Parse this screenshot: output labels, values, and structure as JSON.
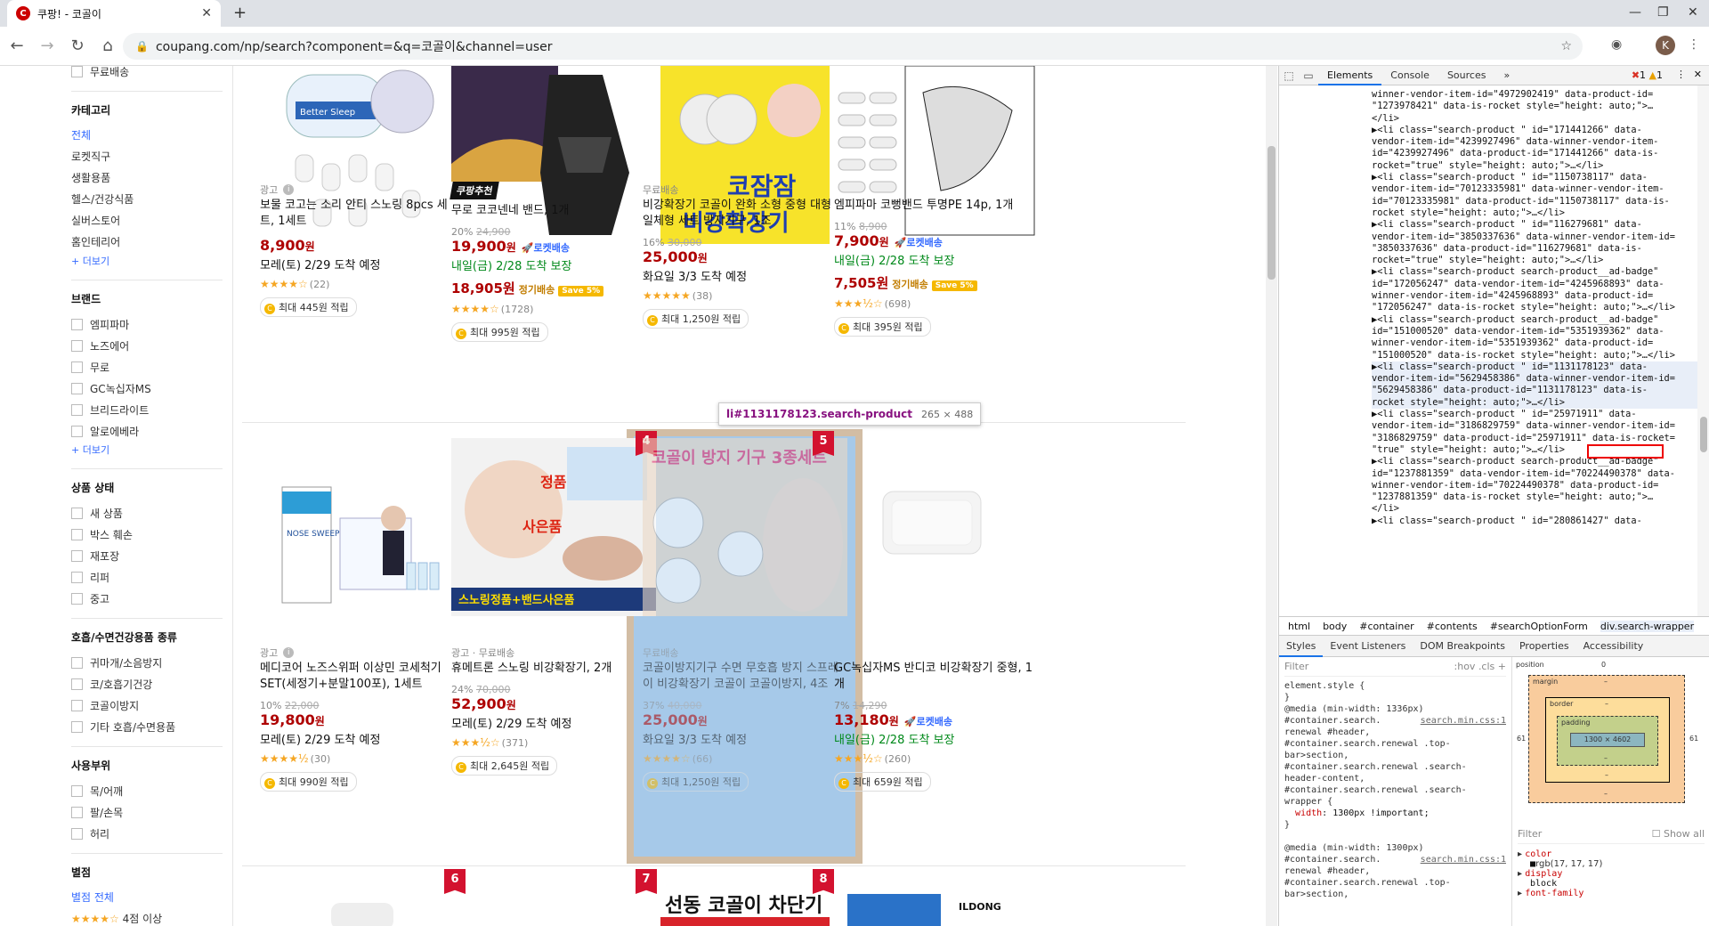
{
  "browser": {
    "tab_title": "쿠팡! - 코골이",
    "favicon": "C",
    "url": "coupang.com/np/search?component=&q=코골이&channel=user",
    "avatar": "K"
  },
  "sidebar": {
    "top_item": "무료배송",
    "category_title": "카테고리",
    "categories": [
      "전체",
      "로켓직구",
      "생활용품",
      "헬스/건강식품",
      "실버스토어",
      "홈인테리어"
    ],
    "more": "+ 더보기",
    "brand_title": "브랜드",
    "brands": [
      "엠피파마",
      "노즈에어",
      "무로",
      "GC녹십자MS",
      "브리드라이트",
      "알로에베라"
    ],
    "condition_title": "상품 상태",
    "conditions": [
      "새 상품",
      "박스 훼손",
      "재포장",
      "리퍼",
      "중고"
    ],
    "sleep_title": "호흡/수면건강용품 종류",
    "sleep_types": [
      "귀마개/소음방지",
      "코/호흡기건강",
      "코골이방지",
      "기타 호흡/수면용품"
    ],
    "usage_title": "사용부위",
    "usage": [
      "목/어깨",
      "팔/손목",
      "허리"
    ],
    "rating_title": "별점",
    "rating_all": "별점 전체",
    "rating_4": "4점 이상"
  },
  "products": [
    {
      "meta": "광고",
      "name": "보물 코고는 소리 안티 스노링 8pcs 세트, 1세트",
      "discount": "",
      "orig": "",
      "price": "8,900",
      "won": "원",
      "rocket": "",
      "delivery": "모레(토) 2/29 도착 예정",
      "green": false,
      "price2": "",
      "rating": "★★★★☆",
      "count": "(22)",
      "cash": "최대 445원 적립"
    },
    {
      "badge": "쿠팡추천",
      "meta": "",
      "name": "무로 코코넨네 밴드, 1개",
      "discount": "20%",
      "orig": "24,900",
      "price": "19,900",
      "won": "원",
      "rocket": "로켓배송",
      "delivery": "내일(금) 2/28 도착 보장",
      "green": true,
      "price2": "18,905",
      "sub": "정기배송",
      "save": "Save 5%",
      "rating": "★★★★☆",
      "count": "(1728)",
      "cash": "최대 995원 적립"
    },
    {
      "meta": "무료배송",
      "name": "비강확장기 코골이 완화 소형 중형 대형 일체형 세트 방지기구, 1조",
      "discount": "16%",
      "orig": "30,000",
      "price": "25,000",
      "won": "원",
      "rocket": "",
      "delivery": "화요일 3/3 도착 예정",
      "green": false,
      "price2": "",
      "rating": "★★★★★",
      "count": "(38)",
      "cash": "최대 1,250원 적립"
    },
    {
      "meta": "",
      "name": "엠피파마 코뻥밴드 투명PE 14p, 1개",
      "discount": "11%",
      "orig": "8,900",
      "price": "7,900",
      "won": "원",
      "rocket": "로켓배송",
      "delivery": "내일(금) 2/28 도착 보장",
      "green": true,
      "price2": "7,505",
      "sub": "정기배송",
      "save": "Save 5%",
      "rating": "★★★½☆",
      "count": "(698)",
      "cash": "최대 395원 적립"
    },
    {
      "meta": "광고",
      "name": "메디코어 노즈스위퍼 이상민 코세척기SET(세정기+분말100포), 1세트",
      "discount": "10%",
      "orig": "22,000",
      "price": "19,800",
      "won": "원",
      "rocket": "",
      "delivery": "모레(토) 2/29 도착 예정",
      "green": false,
      "price2": "",
      "rating": "★★★★½",
      "count": "(30)",
      "cash": "최대 990원 적립"
    },
    {
      "meta": "광고 · 무료배송",
      "name": "휴메트론 스노링 비강확장기, 2개",
      "discount": "24%",
      "orig": "70,000",
      "price": "52,900",
      "won": "원",
      "rocket": "",
      "delivery": "모레(토) 2/29 도착 예정",
      "green": false,
      "price2": "",
      "rating": "★★★½☆",
      "count": "(371)",
      "cash": "최대 2,645원 적립"
    },
    {
      "rank": "4",
      "meta": "무료배송",
      "name": "코골이방지기구 수면 무호흡 방지 스프레이 비강확장기 코골이 코골이방지, 4조",
      "discount": "37%",
      "orig": "40,000",
      "price": "25,000",
      "won": "원",
      "rocket": "",
      "delivery": "화요일 3/3 도착 예정",
      "green": false,
      "price2": "",
      "rating": "★★★★☆",
      "count": "(66)",
      "cash": "최대 1,250원 적립"
    },
    {
      "rank": "5",
      "meta": "",
      "name": "GC녹십자MS 반디코 비강확장기 중형, 1개",
      "discount": "7%",
      "orig": "14,290",
      "price": "13,180",
      "won": "원",
      "rocket": "로켓배송",
      "delivery": "내일(금) 2/28 도착 보장",
      "green": true,
      "price2": "",
      "rating": "★★★½☆",
      "count": "(260)",
      "cash": "최대 659원 적립"
    }
  ],
  "row3_ranks": [
    "6",
    "7",
    "8"
  ],
  "images": {
    "p1_caption": "Better Sleep",
    "p3_text1": "코잠잠",
    "p3_text2": "비강확장기",
    "p6_genuine": "정품",
    "p6_gift": "사은품",
    "p6_banner": "스노링정품+밴드사은품",
    "p5_box": "NOSE SWEEPER",
    "p7_title": "코골이 방지 기구 3종세트",
    "row3_p7": "선동 코골이 차단기",
    "row3_p8": "ILDONG"
  },
  "inspector": {
    "tooltip_selector": "li#1131178123.search-product",
    "tooltip_size": "265 × 488"
  },
  "devtools": {
    "tabs": [
      "Elements",
      "Console",
      "Sources"
    ],
    "errors": "1",
    "warnings": "1",
    "dom_lines": [
      "winner-vendor-item-id=\"4972902419\" data-product-id=",
      "\"1273978421\" data-is-rocket style=\"height: auto;\">…",
      "</li>",
      "▶<li class=\"search-product \" id=\"171441266\" data-",
      "vendor-item-id=\"4239927496\" data-winner-vendor-item-",
      "id=\"4239927496\" data-product-id=\"171441266\" data-is-",
      "rocket=\"true\" style=\"height: auto;\">…</li>",
      "▶<li class=\"search-product \" id=\"1150738117\" data-",
      "vendor-item-id=\"70123335981\" data-winner-vendor-item-",
      "id=\"70123335981\" data-product-id=\"1150738117\" data-is-",
      "rocket style=\"height: auto;\">…</li>",
      "▶<li class=\"search-product \" id=\"116279681\" data-",
      "vendor-item-id=\"3850337636\" data-winner-vendor-item-id=",
      "\"3850337636\" data-product-id=\"116279681\" data-is-",
      "rocket=\"true\" style=\"height: auto;\">…</li>",
      "▶<li class=\"search-product search-product__ad-badge\"",
      "id=\"172056247\" data-vendor-item-id=\"4245968893\" data-",
      "winner-vendor-item-id=\"4245968893\" data-product-id=",
      "\"172056247\" data-is-rocket style=\"height: auto;\">…</li>",
      "▶<li class=\"search-product search-product__ad-badge\"",
      "id=\"151000520\" data-vendor-item-id=\"5351939362\" data-",
      "winner-vendor-item-id=\"5351939362\" data-product-id=",
      "\"151000520\" data-is-rocket style=\"height: auto;\">…</li>",
      "▶<li class=\"search-product \" id=\"1131178123\" data-",
      "vendor-item-id=\"5629458386\" data-winner-vendor-item-id=",
      "\"5629458386\" data-product-id=\"1131178123\" data-is-",
      "rocket style=\"height: auto;\">…</li>",
      "▶<li class=\"search-product \" id=\"25971911\" data-",
      "vendor-item-id=\"3186829759\" data-winner-vendor-item-id=",
      "\"3186829759\" data-product-id=\"25971911\" data-is-rocket=",
      "\"true\" style=\"height: auto;\">…</li>",
      "▶<li class=\"search-product search-product__ad-badge\"",
      "id=\"1237881359\" data-vendor-item-id=\"70224490378\" data-",
      "winner-vendor-item-id=\"70224490378\" data-product-id=",
      "\"1237881359\" data-is-rocket style=\"height: auto;\">…",
      "</li>",
      "▶<li class=\"search-product \" id=\"280861427\" data-"
    ],
    "breadcrumbs": [
      "html",
      "body",
      "#container",
      "#contents",
      "#searchOptionForm",
      "div.search-wrapper"
    ],
    "subtabs": [
      "Styles",
      "Event Listeners",
      "DOM Breakpoints",
      "Properties",
      "Accessibility"
    ],
    "filter": "Filter",
    "hov": ":hov",
    "cls": ".cls",
    "styles_lines": [
      "element.style {",
      "}",
      "@media (min-width: 1336px)",
      "#container.search.",
      "renewal #header,",
      "#container.search.renewal .top-",
      "bar>section,",
      "#container.search.renewal .search-",
      "header-content,",
      "#container.search.renewal .search-",
      "wrapper {",
      "  width: 1300px !important;",
      "}",
      "",
      "@media (min-width: 1300px)",
      "#container.search.",
      "renewal #header,",
      "#container.search.renewal .top-",
      "bar>section,"
    ],
    "styles_src": "search.min.css:1",
    "box_position": "position",
    "box_margin": "margin",
    "box_border": "border",
    "box_padding": "padding",
    "box_content": "1300 × 4602",
    "box_side": "61",
    "box_dash": "–",
    "box_pos_val": "0",
    "computed_filter": "Filter",
    "show_all": "Show all",
    "computed": [
      {
        "p": "color",
        "v": "rgb(17, 17, 17)"
      },
      {
        "p": "display",
        "v": "block"
      },
      {
        "p": "font-family",
        "v": ""
      }
    ]
  }
}
